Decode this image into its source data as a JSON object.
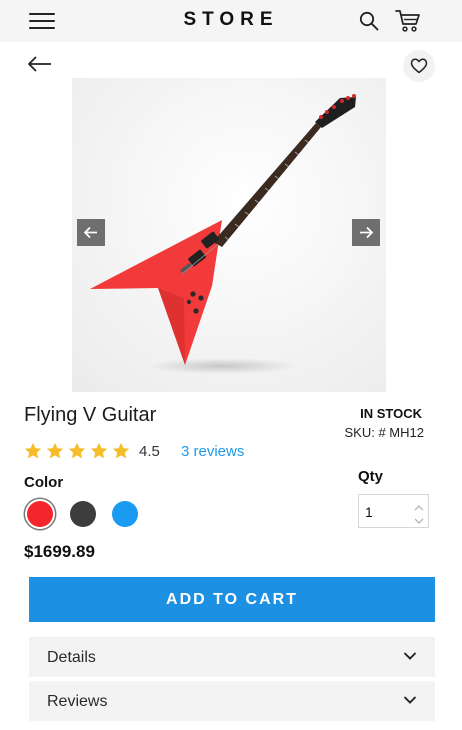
{
  "header": {
    "title": "STORE"
  },
  "product": {
    "name": "Flying V Guitar",
    "stock": "IN STOCK",
    "sku": "SKU: # MH12",
    "rating": {
      "value": "4.5",
      "stars_filled": 5,
      "stars_total": 5,
      "reviews_label": "3 reviews"
    },
    "price": "$1699.89"
  },
  "options": {
    "color_label": "Color",
    "colors": [
      {
        "name": "red",
        "hex": "#f4262b",
        "selected": true
      },
      {
        "name": "dark-gray",
        "hex": "#3d3d3d",
        "selected": false
      },
      {
        "name": "blue",
        "hex": "#1a9af0",
        "selected": false
      }
    ],
    "qty_label": "Qty",
    "qty_value": "1"
  },
  "actions": {
    "add_to_cart": "ADD TO CART"
  },
  "sections": [
    {
      "label": "Details"
    },
    {
      "label": "Reviews"
    }
  ],
  "colors": {
    "accent": "#1c90e2",
    "link": "#1e9be9",
    "star": "#f5bd2a",
    "guitar_body": "#f23a3a"
  },
  "icons": [
    "hamburger-menu-icon",
    "search-icon",
    "cart-icon",
    "back-arrow-icon",
    "heart-icon",
    "arrow-left-icon",
    "arrow-right-icon",
    "star-icon",
    "chevron-down-icon"
  ]
}
